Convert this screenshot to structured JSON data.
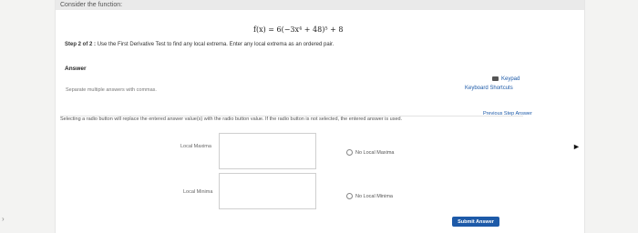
{
  "question": {
    "intro": "Consider the function:",
    "formula": "f(x) = 6(−3x⁴ + 48)⁵ + 8",
    "step_prefix": "Step 2 of 2 :",
    "step_text": "Use the First Derivative Test to find any local extrema. Enter any local extrema as an ordered pair."
  },
  "answer": {
    "label": "Answer",
    "separate_hint": "Separate multiple answers with commas.",
    "keypad_label": "Keypad",
    "shortcuts_label": "Keyboard Shortcuts",
    "previous_step_label": "Previous Step Answer",
    "selecting_note": "Selecting a radio button will replace the entered answer value(s) with the radio button value. If the radio button is not selected, the entered answer is used."
  },
  "fields": {
    "local_maxima_label": "Local Maxima",
    "local_minima_label": "Local Minima",
    "no_local_maxima": "No Local Maxima",
    "no_local_minima": "No Local Minima"
  },
  "buttons": {
    "submit": "Submit Answer"
  },
  "colors": {
    "accent": "#1d5aa8"
  }
}
